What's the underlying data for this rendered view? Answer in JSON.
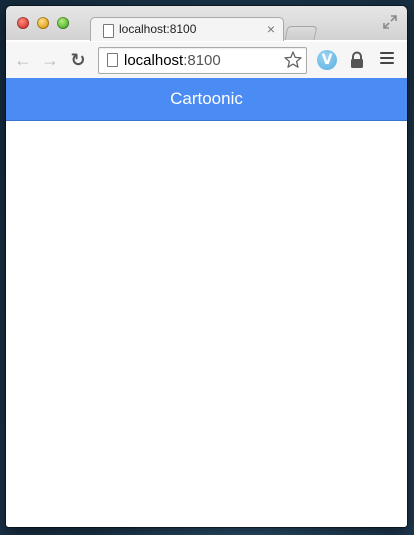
{
  "tab": {
    "title": "localhost:8100",
    "close_glyph": "×"
  },
  "omnibox": {
    "host": "localhost",
    "port": ":8100"
  },
  "toolbar": {
    "back_glyph": "←",
    "forward_glyph": "→",
    "reload_glyph": "↻",
    "extension_letter": "V"
  },
  "app": {
    "title": "Cartoonic",
    "header_color": "#4b8bf4"
  },
  "icons": {
    "fullscreen": "fullscreen-icon",
    "star": "bookmark-star-icon",
    "lock": "lock-icon",
    "menu": "menu-icon",
    "page": "page-icon"
  }
}
